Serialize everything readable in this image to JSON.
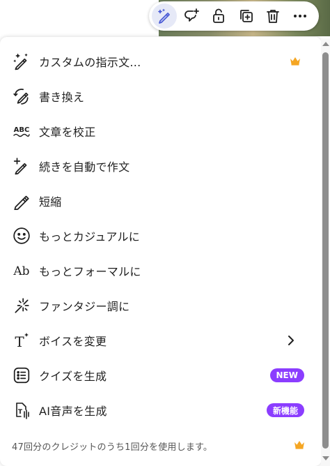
{
  "toolbar": {
    "buttons": [
      {
        "icon": "magic-pen-icon",
        "active": true
      },
      {
        "icon": "add-comment-icon",
        "active": false
      },
      {
        "icon": "unlock-icon",
        "active": false
      },
      {
        "icon": "duplicate-icon",
        "active": false
      },
      {
        "icon": "trash-icon",
        "active": false
      },
      {
        "icon": "more-icon",
        "active": false
      }
    ]
  },
  "menu": {
    "items": [
      {
        "label": "カスタムの指示文...",
        "icon": "magic-pen-icon",
        "premium": true
      },
      {
        "label": "書き換え",
        "icon": "rewrite-icon"
      },
      {
        "label": "文章を校正",
        "icon": "spellcheck-abc-icon",
        "icon_text": "ABC"
      },
      {
        "label": "続きを自動で作文",
        "icon": "pen-plus-icon"
      },
      {
        "label": "短縮",
        "icon": "pencil-icon"
      },
      {
        "label": "もっとカジュアルに",
        "icon": "smiley-icon"
      },
      {
        "label": "もっとフォーマルに",
        "icon": "ab-text-icon",
        "icon_text": "Ab"
      },
      {
        "label": "ファンタジー調に",
        "icon": "sparkle-burst-icon"
      },
      {
        "label": "ボイスを変更",
        "icon": "text-sparkle-icon",
        "icon_text": "T",
        "submenu": true
      },
      {
        "label": "クイズを生成",
        "icon": "list-icon",
        "badge": "NEW"
      },
      {
        "label": "AI音声を生成",
        "icon": "voice-doc-icon",
        "icon_text": "T",
        "badge": "新機能"
      }
    ],
    "footer": "47回分のクレジットのうち1回分を使用します。"
  },
  "colors": {
    "accent_purple": "#8b3dff",
    "crown_gold": "#f5a623",
    "active_bg": "#e6e9f7",
    "active_icon": "#4a5bd6"
  }
}
